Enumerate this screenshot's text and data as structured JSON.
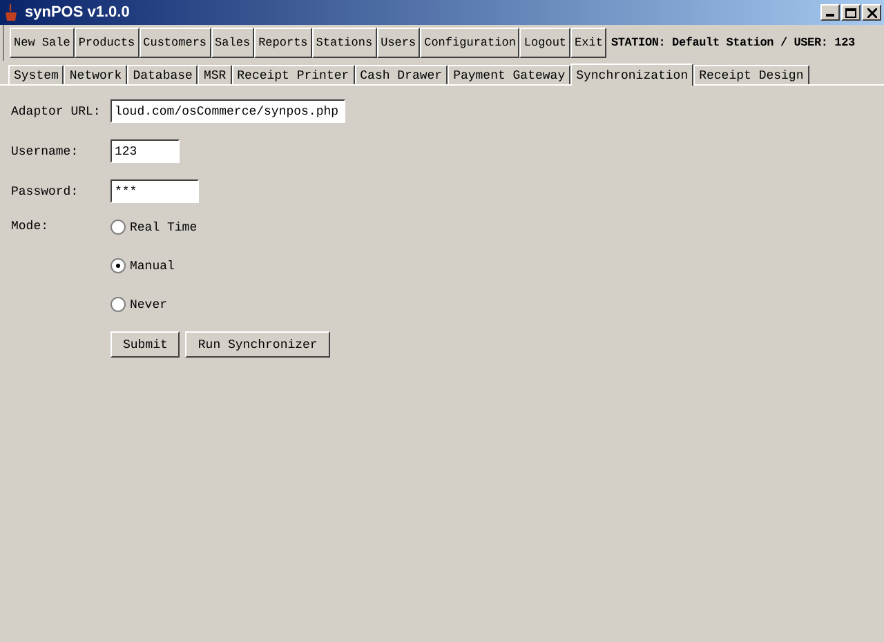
{
  "window": {
    "title": "synPOS v1.0.0"
  },
  "toolbar": {
    "buttons": [
      "New Sale",
      "Products",
      "Customers",
      "Sales",
      "Reports",
      "Stations",
      "Users",
      "Configuration",
      "Logout",
      "Exit"
    ],
    "status": "STATION: Default Station / USER: 123"
  },
  "tabs": [
    {
      "label": "System",
      "selected": false
    },
    {
      "label": "Network",
      "selected": false
    },
    {
      "label": "Database",
      "selected": false
    },
    {
      "label": "MSR",
      "selected": false
    },
    {
      "label": "Receipt Printer",
      "selected": false
    },
    {
      "label": "Cash Drawer",
      "selected": false
    },
    {
      "label": "Payment Gateway",
      "selected": false
    },
    {
      "label": "Synchronization",
      "selected": true
    },
    {
      "label": "Receipt Design",
      "selected": false
    }
  ],
  "form": {
    "fields": [
      {
        "label": "Adaptor URL:",
        "value": "loud.com/osCommerce/synpos.php"
      },
      {
        "label": "Username:",
        "value": "123"
      },
      {
        "label": "Password:",
        "value": "***"
      }
    ],
    "mode": {
      "label": "Mode:",
      "options": [
        {
          "label": "Real Time",
          "selected": false
        },
        {
          "label": "Manual",
          "selected": true
        },
        {
          "label": "Never",
          "selected": false
        }
      ]
    },
    "buttons": [
      "Submit",
      "Run Synchronizer"
    ]
  }
}
